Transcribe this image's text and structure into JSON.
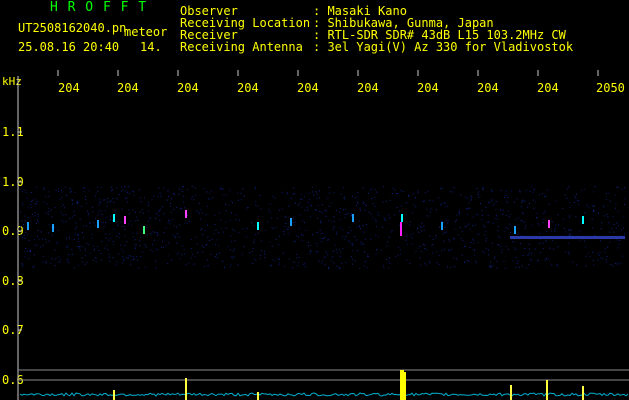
{
  "header": {
    "app_title": "H R O F F T",
    "file_name": "UT2508162040.pn",
    "file_type": "meteor",
    "datetime": "25.08.16 20:40",
    "counter": "14.",
    "info": [
      {
        "label": "Observer",
        "value": ": Masaki Kano"
      },
      {
        "label": "Receiving Location",
        "value": ": Shibukawa, Gunma, Japan"
      },
      {
        "label": "Receiver",
        "value": ": RTL-SDR SDR# 43dB L15 103.2MHz CW"
      },
      {
        "label": "Receiving Antenna",
        "value": ": 3el Yagi(V) Az 330 for Vladivostok"
      }
    ]
  },
  "spectrogram": {
    "unit_label": "kHz",
    "time_ticks": [
      "204",
      "204",
      "204",
      "204",
      "204",
      "204",
      "204",
      "204",
      "204",
      "2050"
    ],
    "freq_ticks": [
      "1.1",
      "1.0",
      "0.9",
      "0.8",
      "0.7",
      "0.6"
    ],
    "colors": {
      "text_yellow": "#ffff00",
      "text_green": "#00ff00",
      "signal": "#00ffff",
      "peak": "#ff00ff"
    }
  }
}
